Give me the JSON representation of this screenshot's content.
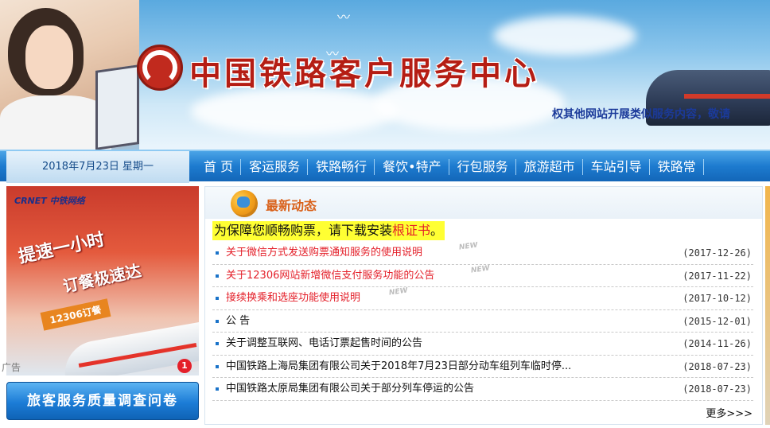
{
  "banner": {
    "site_title": "中国铁路客户服务中心",
    "marquee_text": "权其他网站开展类似服务内容，敬请"
  },
  "navbar": {
    "date": "2018年7月23日 星期一",
    "items": [
      {
        "label": "首 页"
      },
      {
        "label": "客运服务"
      },
      {
        "label": "铁路畅行"
      },
      {
        "label": "餐饮•特产"
      },
      {
        "label": "行包服务"
      },
      {
        "label": "旅游超市"
      },
      {
        "label": "车站引导"
      },
      {
        "label": "铁路常"
      }
    ]
  },
  "ad": {
    "logo": "CRNET 中铁网络",
    "headline_1": "提速一小时",
    "headline_2": "订餐极速达",
    "tag": "12306订餐",
    "label": "广告",
    "badge": "1"
  },
  "survey_button": {
    "label": "旅客服务质量调查问卷"
  },
  "news": {
    "title": "最新动态",
    "notice_prefix": "为保障您顺畅购票，请下载安装",
    "notice_link": "根证书",
    "notice_suffix": "。",
    "items": [
      {
        "title": "关于微信方式发送购票通知服务的使用说明",
        "date": "(2017-12-26)",
        "is_new": true,
        "new_label": "NEW"
      },
      {
        "title": "关于12306网站新增微信支付服务功能的公告",
        "date": "(2017-11-22)",
        "is_new": true,
        "new_label": "NEW"
      },
      {
        "title": "接续换乘和选座功能使用说明",
        "date": "(2017-10-12)",
        "is_new": true,
        "new_label": "NEW"
      },
      {
        "title": "公 告",
        "date": "(2015-12-01)",
        "is_new": false
      },
      {
        "title": "关于调整互联网、电话订票起售时间的公告",
        "date": "(2014-11-26)",
        "is_new": false
      },
      {
        "title": "中国铁路上海局集团有限公司关于2018年7月23日部分动车组列车临时停...",
        "date": "(2018-07-23)",
        "is_new": false
      },
      {
        "title": "中国铁路太原局集团有限公司关于部分列车停运的公告",
        "date": "(2018-07-23)",
        "is_new": false
      }
    ],
    "more_label": "更多>>>"
  },
  "colors": {
    "nav_blue": "#1d7bcf",
    "title_red": "#b51d14",
    "news_red": "#e4202a",
    "highlight_yellow": "#ffff33",
    "news_header_orange": "#d9611a"
  }
}
